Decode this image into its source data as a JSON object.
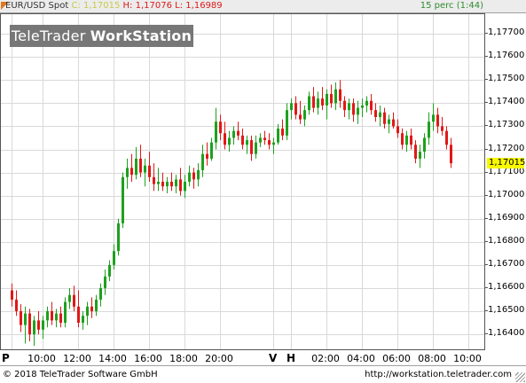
{
  "header": {
    "symbol": "EUR/USD Spot",
    "c_label": "C:",
    "c_value": "1,17015",
    "h_label": "H:",
    "h_value": "1,17076",
    "l_label": "L:",
    "l_value": "1,16989",
    "period": "15 perc (1:44)"
  },
  "watermark": {
    "brand": "TeleTrader",
    "product": "WorkStation"
  },
  "footer": {
    "copyright": "© 2018 TeleTrader Software GmbH",
    "url": "http://workstation.teletrader.com"
  },
  "colors": {
    "up": "#1ea01e",
    "down": "#e01818",
    "grid": "#d9d9d9",
    "frame": "#555555",
    "last_price_bg": "#f8f800"
  },
  "chart_data": {
    "type": "candlestick",
    "title": "EUR/USD Spot",
    "interval": "15 perc",
    "ylim": [
      1.16335,
      1.17785
    ],
    "grid": true,
    "y_ticks": [
      "1,17700",
      "1,17600",
      "1,17500",
      "1,17400",
      "1,17300",
      "1,17200",
      "1,17100",
      "1,17000",
      "1,16900",
      "1,16800",
      "1,16700",
      "1,16600",
      "1,16500",
      "1,16400"
    ],
    "y_tick_values": [
      1.177,
      1.176,
      1.175,
      1.174,
      1.173,
      1.172,
      1.171,
      1.17,
      1.169,
      1.168,
      1.167,
      1.166,
      1.165,
      1.164
    ],
    "x_ticks": [
      {
        "label": "P",
        "kind": "day",
        "bar": 0
      },
      {
        "label": "10:00",
        "kind": "time",
        "bar": 7
      },
      {
        "label": "12:00",
        "kind": "time",
        "bar": 15
      },
      {
        "label": "14:00",
        "kind": "time",
        "bar": 23
      },
      {
        "label": "16:00",
        "kind": "time",
        "bar": 31
      },
      {
        "label": "18:00",
        "kind": "time",
        "bar": 39
      },
      {
        "label": "20:00",
        "kind": "time",
        "bar": 47
      },
      {
        "label": "V",
        "kind": "day",
        "bar": 59
      },
      {
        "label": "H",
        "kind": "day",
        "bar": 63
      },
      {
        "label": "02:00",
        "kind": "time",
        "bar": 71
      },
      {
        "label": "04:00",
        "kind": "time",
        "bar": 79
      },
      {
        "label": "06:00",
        "kind": "time",
        "bar": 87
      },
      {
        "label": "08:00",
        "kind": "time",
        "bar": 95
      },
      {
        "label": "10:00",
        "kind": "time",
        "bar": 103
      }
    ],
    "bar_count": 108,
    "ohlc": [
      [
        1.1659,
        1.1662,
        1.1652,
        1.1655
      ],
      [
        1.1655,
        1.1659,
        1.1648,
        1.165
      ],
      [
        1.165,
        1.1653,
        1.1641,
        1.1644
      ],
      [
        1.1644,
        1.1652,
        1.1636,
        1.1649
      ],
      [
        1.1649,
        1.1651,
        1.1637,
        1.164
      ],
      [
        1.164,
        1.1648,
        1.1635,
        1.1646
      ],
      [
        1.1646,
        1.165,
        1.164,
        1.1642
      ],
      [
        1.1642,
        1.1648,
        1.1638,
        1.1646
      ],
      [
        1.1646,
        1.1652,
        1.1643,
        1.165
      ],
      [
        1.165,
        1.1654,
        1.1644,
        1.1646
      ],
      [
        1.1646,
        1.1651,
        1.1643,
        1.1649
      ],
      [
        1.1649,
        1.1652,
        1.1643,
        1.1645
      ],
      [
        1.1645,
        1.1656,
        1.1643,
        1.1654
      ],
      [
        1.1654,
        1.166,
        1.1651,
        1.1657
      ],
      [
        1.1657,
        1.1661,
        1.165,
        1.1652
      ],
      [
        1.1652,
        1.1659,
        1.1643,
        1.1645
      ],
      [
        1.1645,
        1.165,
        1.1642,
        1.1648
      ],
      [
        1.1648,
        1.1654,
        1.1644,
        1.1652
      ],
      [
        1.1652,
        1.1656,
        1.1647,
        1.165
      ],
      [
        1.165,
        1.1657,
        1.1648,
        1.1655
      ],
      [
        1.1655,
        1.1662,
        1.1652,
        1.166
      ],
      [
        1.166,
        1.1668,
        1.1657,
        1.1665
      ],
      [
        1.1665,
        1.1672,
        1.1663,
        1.167
      ],
      [
        1.167,
        1.1679,
        1.1668,
        1.1676
      ],
      [
        1.1676,
        1.169,
        1.1674,
        1.1688
      ],
      [
        1.1688,
        1.171,
        1.1686,
        1.1708
      ],
      [
        1.1708,
        1.1716,
        1.1703,
        1.1712
      ],
      [
        1.1712,
        1.1718,
        1.1706,
        1.1709
      ],
      [
        1.1709,
        1.1721,
        1.1707,
        1.1716
      ],
      [
        1.1716,
        1.1722,
        1.1708,
        1.171
      ],
      [
        1.171,
        1.1716,
        1.1704,
        1.1713
      ],
      [
        1.1713,
        1.1719,
        1.1706,
        1.1708
      ],
      [
        1.1708,
        1.1714,
        1.1702,
        1.1705
      ],
      [
        1.1705,
        1.1712,
        1.1702,
        1.1706
      ],
      [
        1.1706,
        1.171,
        1.1702,
        1.1704
      ],
      [
        1.1704,
        1.1708,
        1.1701,
        1.1706
      ],
      [
        1.1706,
        1.171,
        1.1702,
        1.1704
      ],
      [
        1.1704,
        1.1709,
        1.1701,
        1.1707
      ],
      [
        1.1707,
        1.1712,
        1.17,
        1.1702
      ],
      [
        1.1702,
        1.1709,
        1.1699,
        1.1706
      ],
      [
        1.1706,
        1.1713,
        1.1704,
        1.171
      ],
      [
        1.171,
        1.1712,
        1.1703,
        1.1707
      ],
      [
        1.1707,
        1.1714,
        1.1704,
        1.1711
      ],
      [
        1.1711,
        1.1722,
        1.1708,
        1.1718
      ],
      [
        1.1718,
        1.1723,
        1.1713,
        1.1716
      ],
      [
        1.1716,
        1.1725,
        1.1715,
        1.1723
      ],
      [
        1.1723,
        1.1738,
        1.172,
        1.1732
      ],
      [
        1.1732,
        1.1735,
        1.1724,
        1.1727
      ],
      [
        1.1727,
        1.1732,
        1.172,
        1.1722
      ],
      [
        1.1722,
        1.1728,
        1.1719,
        1.1725
      ],
      [
        1.1725,
        1.173,
        1.1722,
        1.1728
      ],
      [
        1.1728,
        1.1732,
        1.1724,
        1.1726
      ],
      [
        1.1726,
        1.1729,
        1.172,
        1.1722
      ],
      [
        1.1722,
        1.1726,
        1.1718,
        1.1724
      ],
      [
        1.1724,
        1.1726,
        1.1715,
        1.1718
      ],
      [
        1.1718,
        1.1726,
        1.1716,
        1.1723
      ],
      [
        1.1723,
        1.1727,
        1.1721,
        1.1725
      ],
      [
        1.1725,
        1.1728,
        1.1722,
        1.1724
      ],
      [
        1.1724,
        1.1727,
        1.172,
        1.1722
      ],
      [
        1.1722,
        1.1725,
        1.1718,
        1.1723
      ],
      [
        1.1723,
        1.1731,
        1.1722,
        1.1729
      ],
      [
        1.1729,
        1.1733,
        1.1724,
        1.1726
      ],
      [
        1.1726,
        1.174,
        1.1724,
        1.1737
      ],
      [
        1.1737,
        1.1742,
        1.1733,
        1.174
      ],
      [
        1.174,
        1.1743,
        1.1733,
        1.1735
      ],
      [
        1.1735,
        1.1741,
        1.1731,
        1.1733
      ],
      [
        1.1733,
        1.1739,
        1.173,
        1.1737
      ],
      [
        1.1737,
        1.1745,
        1.1735,
        1.1743
      ],
      [
        1.1743,
        1.1747,
        1.1736,
        1.1738
      ],
      [
        1.1738,
        1.1745,
        1.1735,
        1.1742
      ],
      [
        1.1742,
        1.1747,
        1.1737,
        1.1739
      ],
      [
        1.1739,
        1.1746,
        1.1733,
        1.1744
      ],
      [
        1.1744,
        1.1748,
        1.1738,
        1.174
      ],
      [
        1.174,
        1.1749,
        1.1737,
        1.1746
      ],
      [
        1.1746,
        1.175,
        1.1738,
        1.1741
      ],
      [
        1.1741,
        1.1743,
        1.1734,
        1.1737
      ],
      [
        1.1737,
        1.1742,
        1.1733,
        1.174
      ],
      [
        1.174,
        1.1742,
        1.1732,
        1.1735
      ],
      [
        1.1735,
        1.1741,
        1.1731,
        1.1738
      ],
      [
        1.1738,
        1.1742,
        1.1734,
        1.1739
      ],
      [
        1.1739,
        1.1743,
        1.1736,
        1.1741
      ],
      [
        1.1741,
        1.1744,
        1.1735,
        1.1737
      ],
      [
        1.1737,
        1.174,
        1.1732,
        1.1734
      ],
      [
        1.1734,
        1.1739,
        1.173,
        1.1736
      ],
      [
        1.1736,
        1.1738,
        1.1729,
        1.1731
      ],
      [
        1.1731,
        1.1735,
        1.1727,
        1.1733
      ],
      [
        1.1733,
        1.1736,
        1.1729,
        1.173
      ],
      [
        1.173,
        1.1733,
        1.1725,
        1.1727
      ],
      [
        1.1727,
        1.1729,
        1.172,
        1.1722
      ],
      [
        1.1722,
        1.1728,
        1.1719,
        1.1726
      ],
      [
        1.1726,
        1.1729,
        1.172,
        1.1722
      ],
      [
        1.1722,
        1.1724,
        1.1714,
        1.1716
      ],
      [
        1.1716,
        1.1722,
        1.1712,
        1.1719
      ],
      [
        1.1719,
        1.1727,
        1.1716,
        1.1725
      ],
      [
        1.1725,
        1.1736,
        1.1722,
        1.1732
      ],
      [
        1.1732,
        1.174,
        1.1728,
        1.1735
      ],
      [
        1.1735,
        1.1738,
        1.1727,
        1.173
      ],
      [
        1.173,
        1.1734,
        1.1726,
        1.1728
      ],
      [
        1.1728,
        1.173,
        1.172,
        1.1722
      ],
      [
        1.1722,
        1.1725,
        1.1712,
        1.1714
      ],
      [
        1.1714,
        1.1716,
        1.17,
        1.1702
      ],
      [
        1.1702,
        1.1704,
        1.16989,
        1.17015
      ],
      [
        1.17015,
        1.1706,
        1.1699,
        1.1704
      ],
      [
        1.1704,
        1.1707,
        1.17,
        1.1702
      ],
      [
        1.1702,
        1.1706,
        1.1699,
        1.1703
      ],
      [
        1.1703,
        1.17076,
        1.17,
        1.17015
      ],
      [
        1.17015,
        1.1704,
        1.1699,
        1.1702
      ],
      [
        1.1702,
        1.1704,
        1.16989,
        1.17015
      ]
    ],
    "visible_bars": 100,
    "last_price": "1,17015"
  }
}
